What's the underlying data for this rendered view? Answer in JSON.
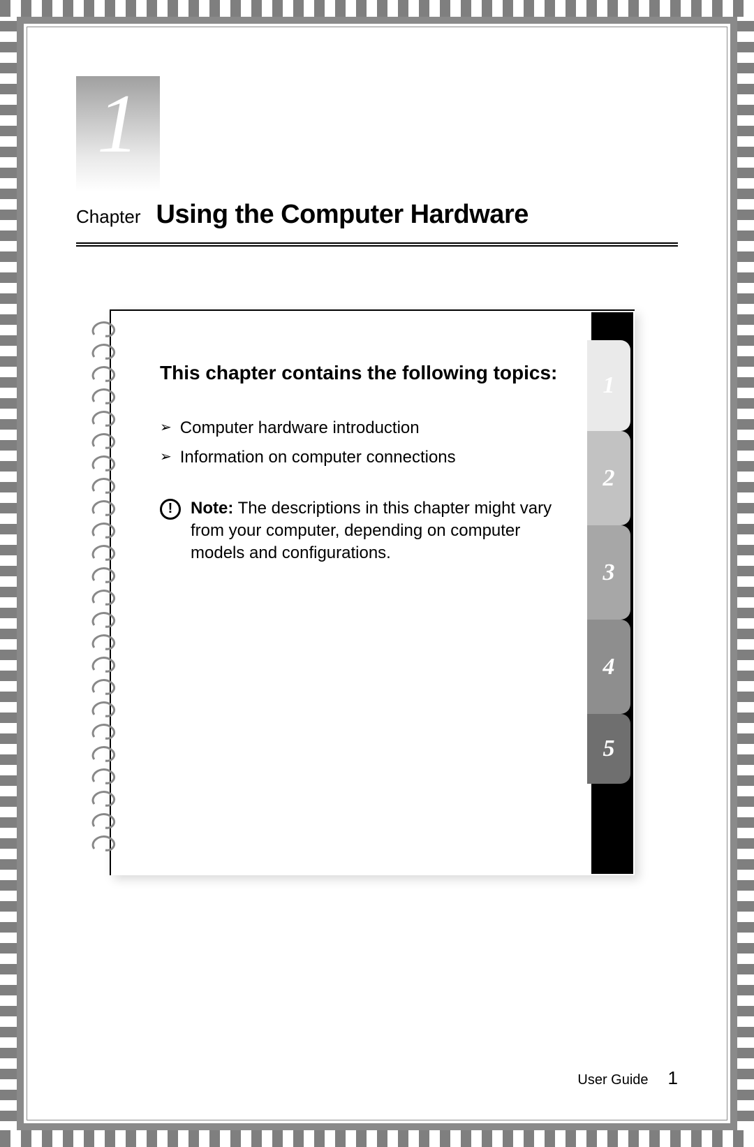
{
  "chapter": {
    "number": "1",
    "label": "Chapter",
    "title": "Using the Computer Hardware"
  },
  "notebook": {
    "heading": "This chapter contains the following topics:",
    "topics": [
      "Computer hardware introduction",
      "Information on computer connections"
    ],
    "note": {
      "label": "Note:",
      "text": "The descriptions in this chapter might vary from your computer, depending on computer models and configurations."
    },
    "tabs": [
      "1",
      "2",
      "3",
      "4",
      "5"
    ]
  },
  "footer": {
    "doc_name": "User Guide",
    "page_number": "1"
  }
}
